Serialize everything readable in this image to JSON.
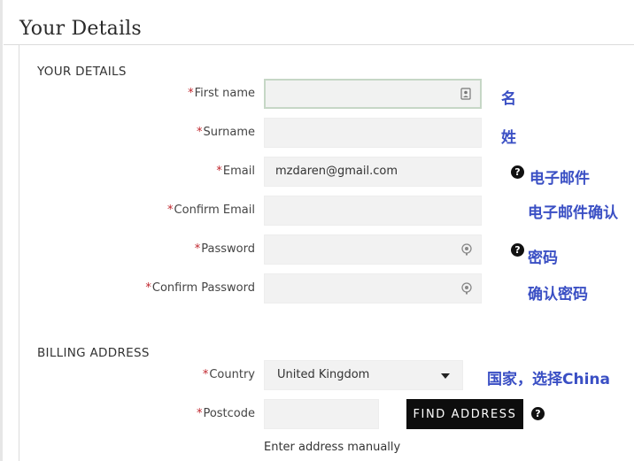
{
  "page": {
    "title": "Your Details"
  },
  "your_details": {
    "heading": "YOUR DETAILS",
    "required_mark": "*",
    "fields": {
      "first_name": {
        "label": "First name",
        "value": "",
        "note": "名"
      },
      "surname": {
        "label": "Surname",
        "value": "",
        "note": "姓"
      },
      "email": {
        "label": "Email",
        "value": "mzdaren@gmail.com",
        "note": "电子邮件"
      },
      "confirm_email": {
        "label": "Confirm Email",
        "value": "",
        "note": "电子邮件确认"
      },
      "password": {
        "label": "Password",
        "value": "",
        "note": "密码"
      },
      "confirm_password": {
        "label": "Confirm Password",
        "value": "",
        "note": "确认密码"
      }
    }
  },
  "billing": {
    "heading": "BILLING ADDRESS",
    "country": {
      "label": "Country",
      "value": "United Kingdom",
      "note": "国家，选择China"
    },
    "postcode": {
      "label": "Postcode",
      "value": ""
    },
    "find_address_label": "FIND ADDRESS",
    "manual_link": "Enter address manually"
  },
  "icons": {
    "help": "question-circle-icon",
    "contact_card": "contact-card-icon",
    "password_reveal": "password-reveal-icon",
    "select_caret": "caret-down-icon"
  },
  "colors": {
    "required": "#c0262d",
    "note_text": "#3a4fc4",
    "field_bg": "#f2f2f2",
    "button_bg": "#0d0d0d",
    "focus_border": "#c6d7c6"
  }
}
